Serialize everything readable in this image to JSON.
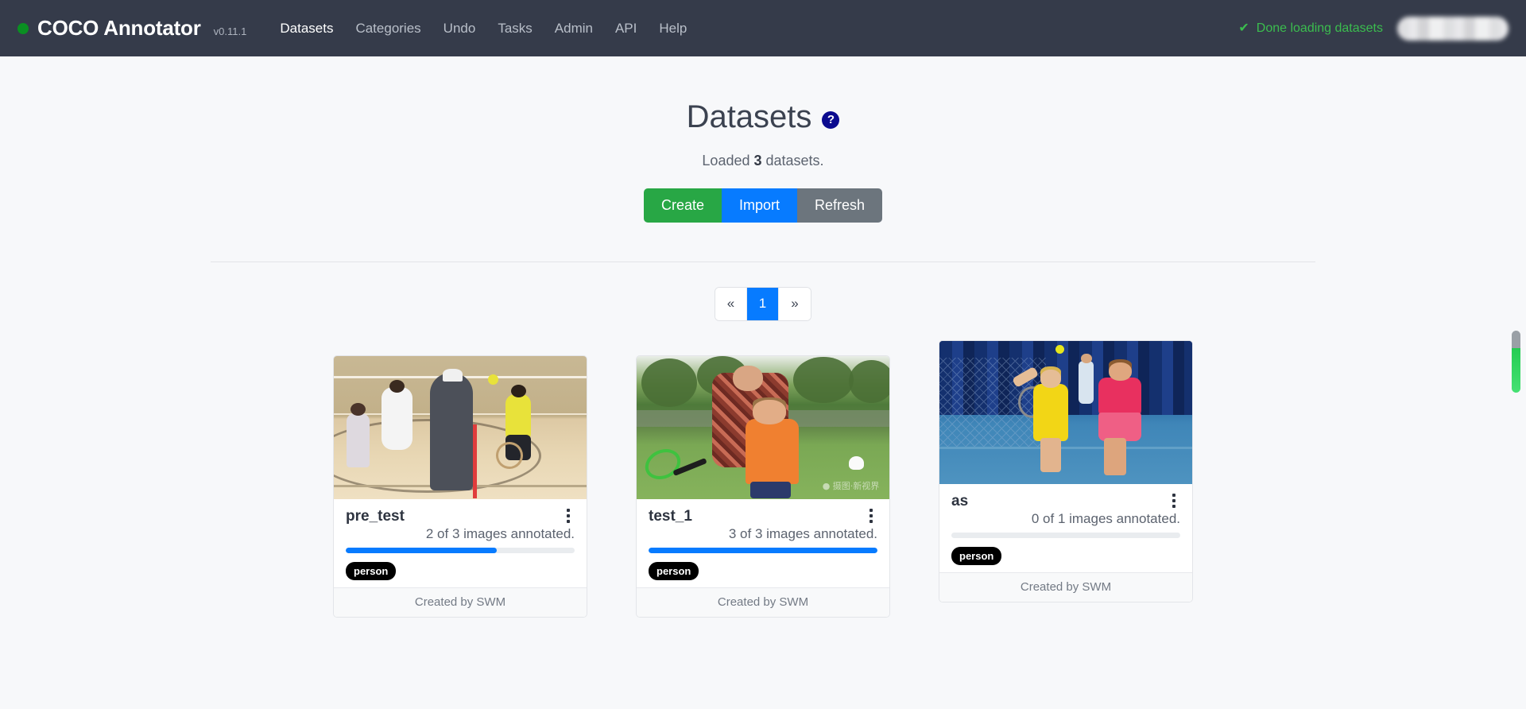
{
  "navbar": {
    "status_dot_color": "#0a8f22",
    "brand": "COCO Annotator",
    "version": "v0.11.1",
    "links": [
      {
        "label": "Datasets",
        "active": true
      },
      {
        "label": "Categories",
        "active": false
      },
      {
        "label": "Undo",
        "active": false
      },
      {
        "label": "Tasks",
        "active": false
      },
      {
        "label": "Admin",
        "active": false
      },
      {
        "label": "API",
        "active": false
      },
      {
        "label": "Help",
        "active": false
      }
    ],
    "load_status": "Done loading datasets",
    "check_icon": "check-icon",
    "user_chip": ""
  },
  "page": {
    "title": "Datasets",
    "help_icon": "?",
    "loaded_prefix": "Loaded ",
    "loaded_count": "3",
    "loaded_suffix": " datasets."
  },
  "toolbar": {
    "create_label": "Create",
    "import_label": "Import",
    "refresh_label": "Refresh",
    "create_color": "#28a745",
    "import_color": "#077bff",
    "refresh_color": "#6c757d"
  },
  "pagination": {
    "prev_label": "«",
    "next_label": "»",
    "current_page": "1"
  },
  "datasets": [
    {
      "name": "pre_test",
      "annotated_text": "2 of 3 images annotated.",
      "progress_percent": 66,
      "categories": [
        "person"
      ],
      "created_by": "Created by SWM",
      "thumbnail": "indoor-gym-badminton-photo",
      "menu_icon": "kebab-menu-icon"
    },
    {
      "name": "test_1",
      "annotated_text": "3 of 3 images annotated.",
      "progress_percent": 100,
      "categories": [
        "person"
      ],
      "created_by": "Created by SWM",
      "thumbnail": "park-father-and-son-badminton-photo",
      "menu_icon": "kebab-menu-icon"
    },
    {
      "name": "as",
      "annotated_text": "0 of 1 images annotated.",
      "progress_percent": 0,
      "categories": [
        "person"
      ],
      "created_by": "Created by SWM",
      "thumbnail": "blue-court-two-players-photo",
      "menu_icon": "kebab-menu-icon"
    }
  ],
  "scrollbar": {
    "thumb_top_color": "#9aa0a6",
    "thumb_bottom_color": "#2ed65b"
  }
}
